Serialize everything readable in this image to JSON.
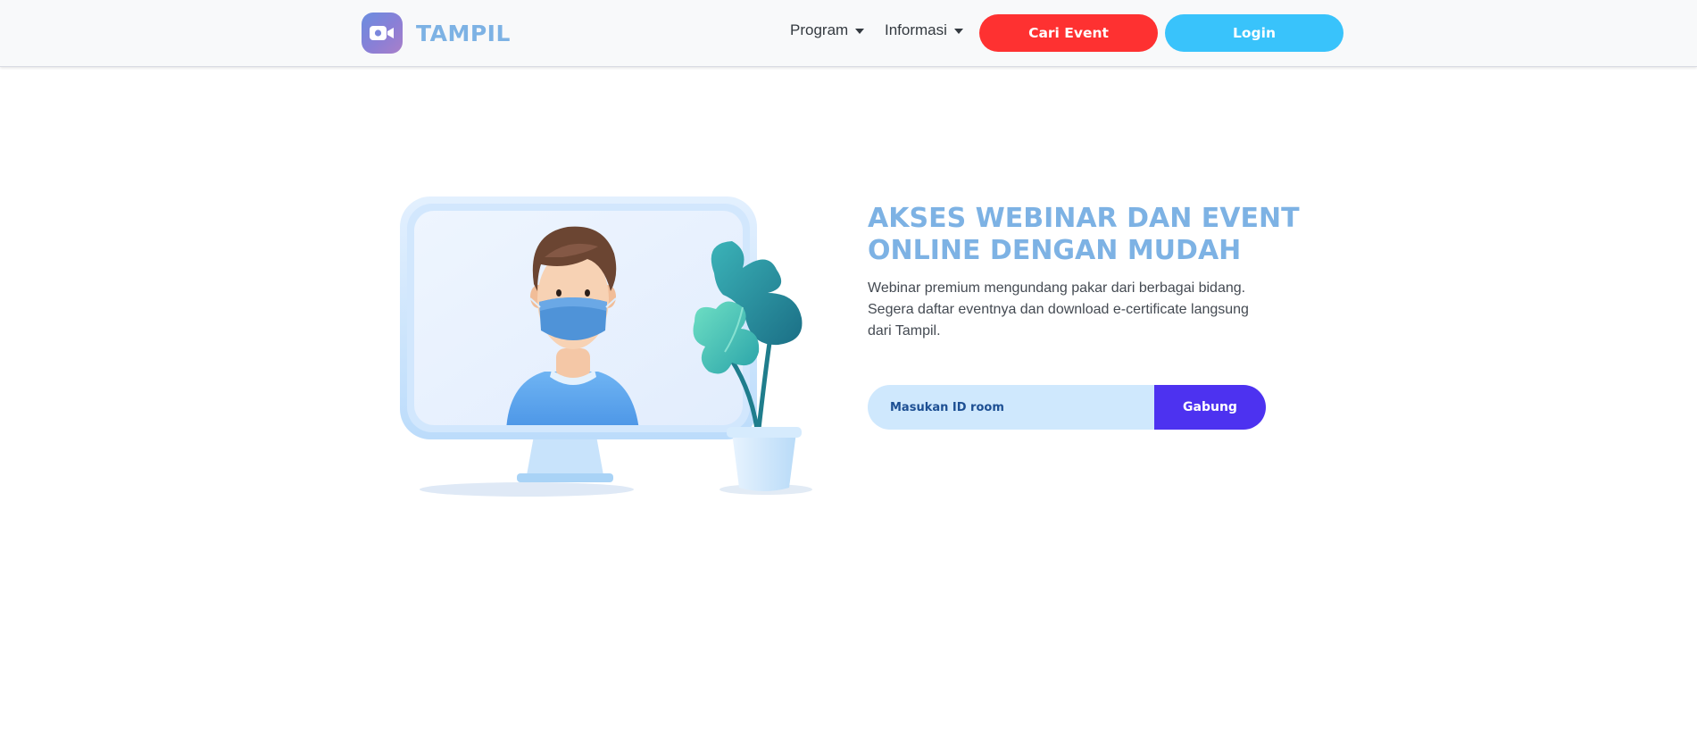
{
  "brand": {
    "name": "TAMPIL",
    "logo_icon": "video-camera-icon",
    "logo_color": "#7b87dc"
  },
  "nav": {
    "program_label": "Program",
    "informasi_label": "Informasi",
    "cari_event_label": "Cari Event",
    "login_label": "Login"
  },
  "hero": {
    "headline_line1": "AKSES WEBINAR DAN EVENT",
    "headline_line2": "ONLINE DENGAN MUDAH",
    "description": "Webinar premium mengundang pakar dari berbagai bidang. Segera daftar eventnya dan download e-certificate langsung dari Tampil.",
    "room_input_placeholder": "Masukan ID room",
    "join_label": "Gabung",
    "illustration_icon": "masked-person-monitor-plant-illustration"
  },
  "colors": {
    "accent_blue": "#7db2e4",
    "cari_event_red": "#fe3131",
    "login_blue": "#39c3fb",
    "join_purple": "#4d32f0",
    "input_bg": "#cfe8fd"
  }
}
